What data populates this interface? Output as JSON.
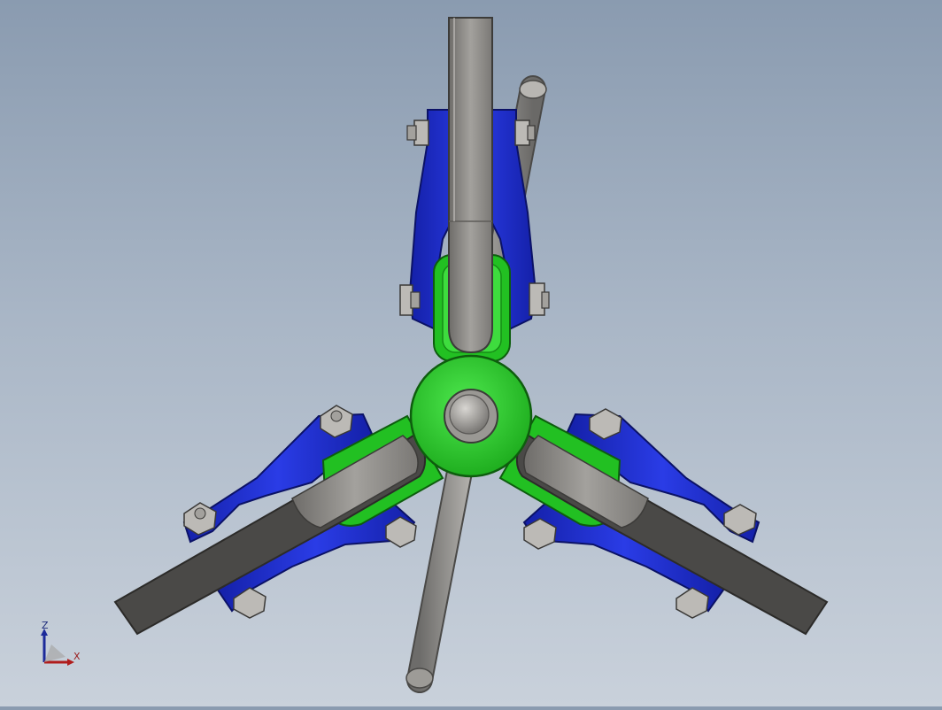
{
  "viewport": {
    "background_top": "#8a9bb0",
    "background_bottom": "#c9d1db"
  },
  "model": {
    "description_colors": {
      "green_hub": "#2fd22f",
      "blue_clevis": "#1f2ed8",
      "grey_bar": "#8d8b87",
      "dark_bar": "#3c3c3c"
    },
    "arms": [
      "top",
      "lower-left",
      "lower-right"
    ]
  },
  "triad": {
    "z_label": "Z",
    "x_label": "X",
    "z_color": "#1c2a9a",
    "x_color": "#b01c1c"
  }
}
